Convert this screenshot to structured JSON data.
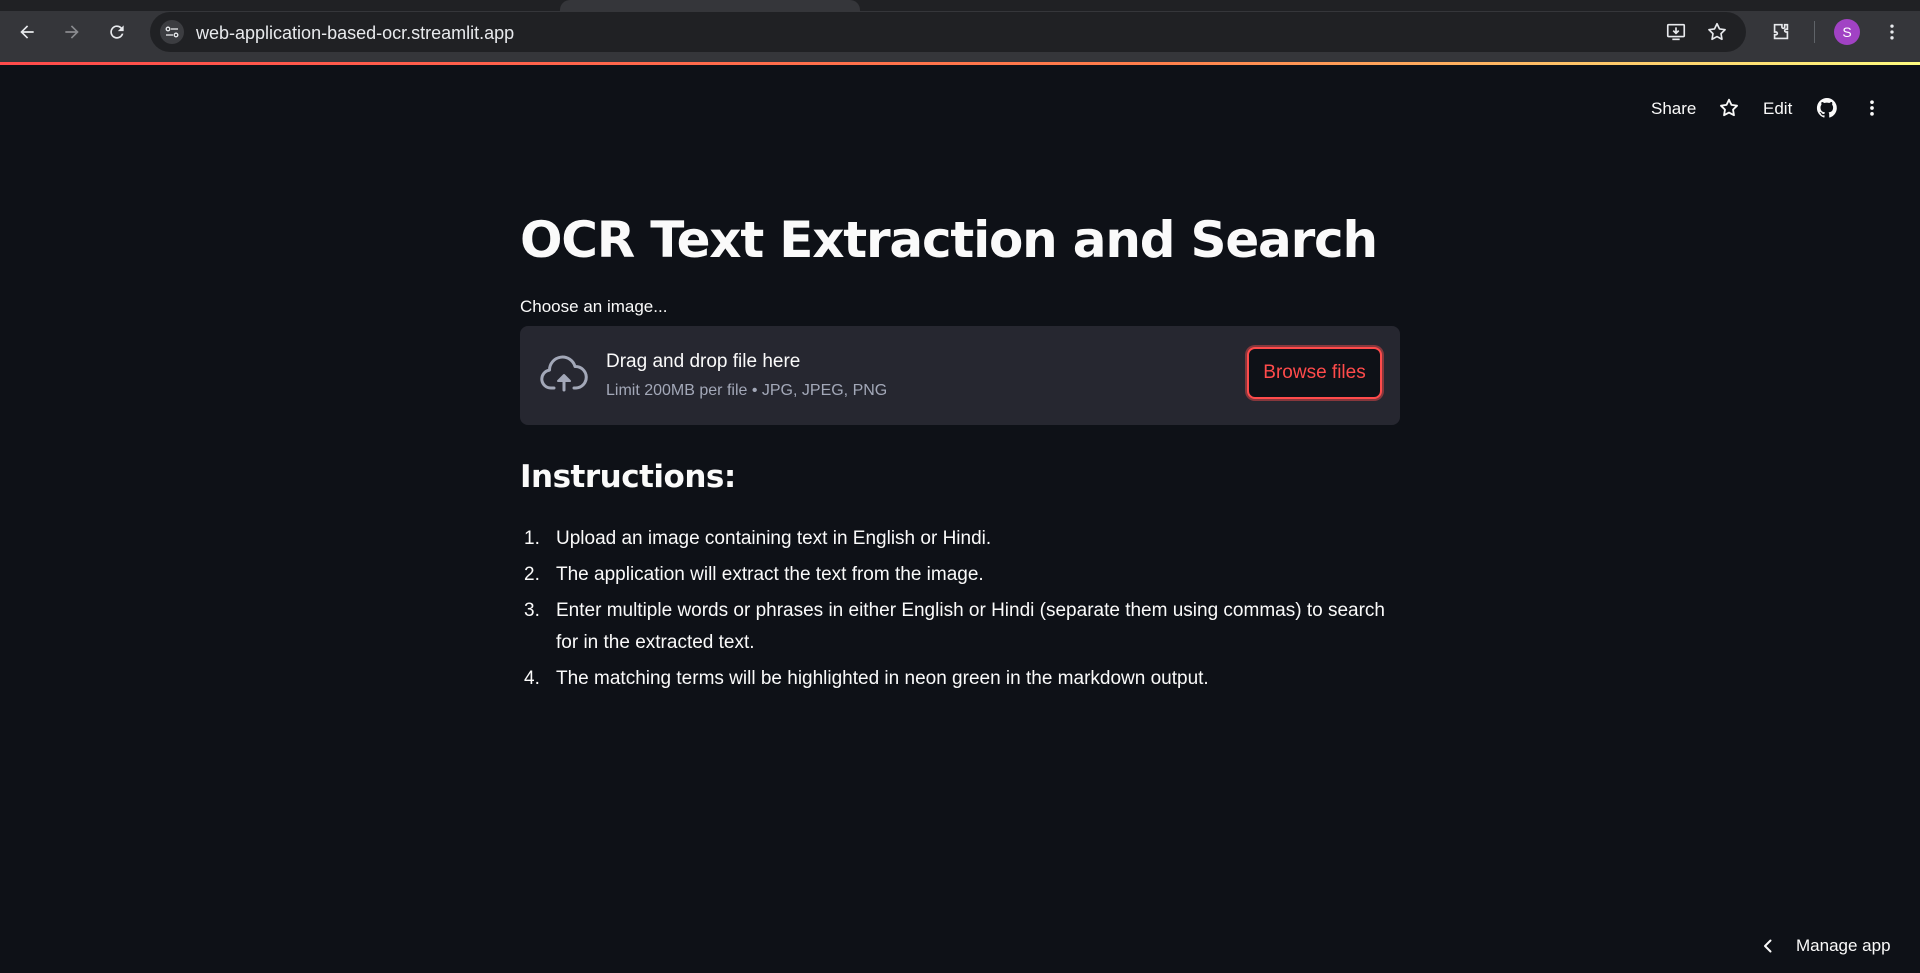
{
  "browser": {
    "url": "web-application-based-ocr.streamlit.app",
    "profile_initial": "S"
  },
  "header": {
    "share_label": "Share",
    "edit_label": "Edit"
  },
  "main": {
    "title": "OCR Text Extraction and Search",
    "uploader": {
      "label": "Choose an image...",
      "drop_title": "Drag and drop file here",
      "drop_limit": "Limit 200MB per file • JPG, JPEG, PNG",
      "browse_label": "Browse files"
    },
    "instructions_heading": "Instructions:",
    "instructions": [
      {
        "num": "1.",
        "text": "Upload an image containing text in English or Hindi."
      },
      {
        "num": "2.",
        "text": "The application will extract the text from the image."
      },
      {
        "num": "3.",
        "text": "Enter multiple words or phrases in either English or Hindi (separate them using commas) to search for in the extracted text."
      },
      {
        "num": "4.",
        "text": "The matching terms will be highlighted in neon green in the markdown output."
      }
    ]
  },
  "footer": {
    "manage_app_label": "Manage app"
  },
  "colors": {
    "background": "#0e1117",
    "accent": "#ff4b4b",
    "dropzone": "#262730",
    "browser_bar": "#35363a"
  }
}
